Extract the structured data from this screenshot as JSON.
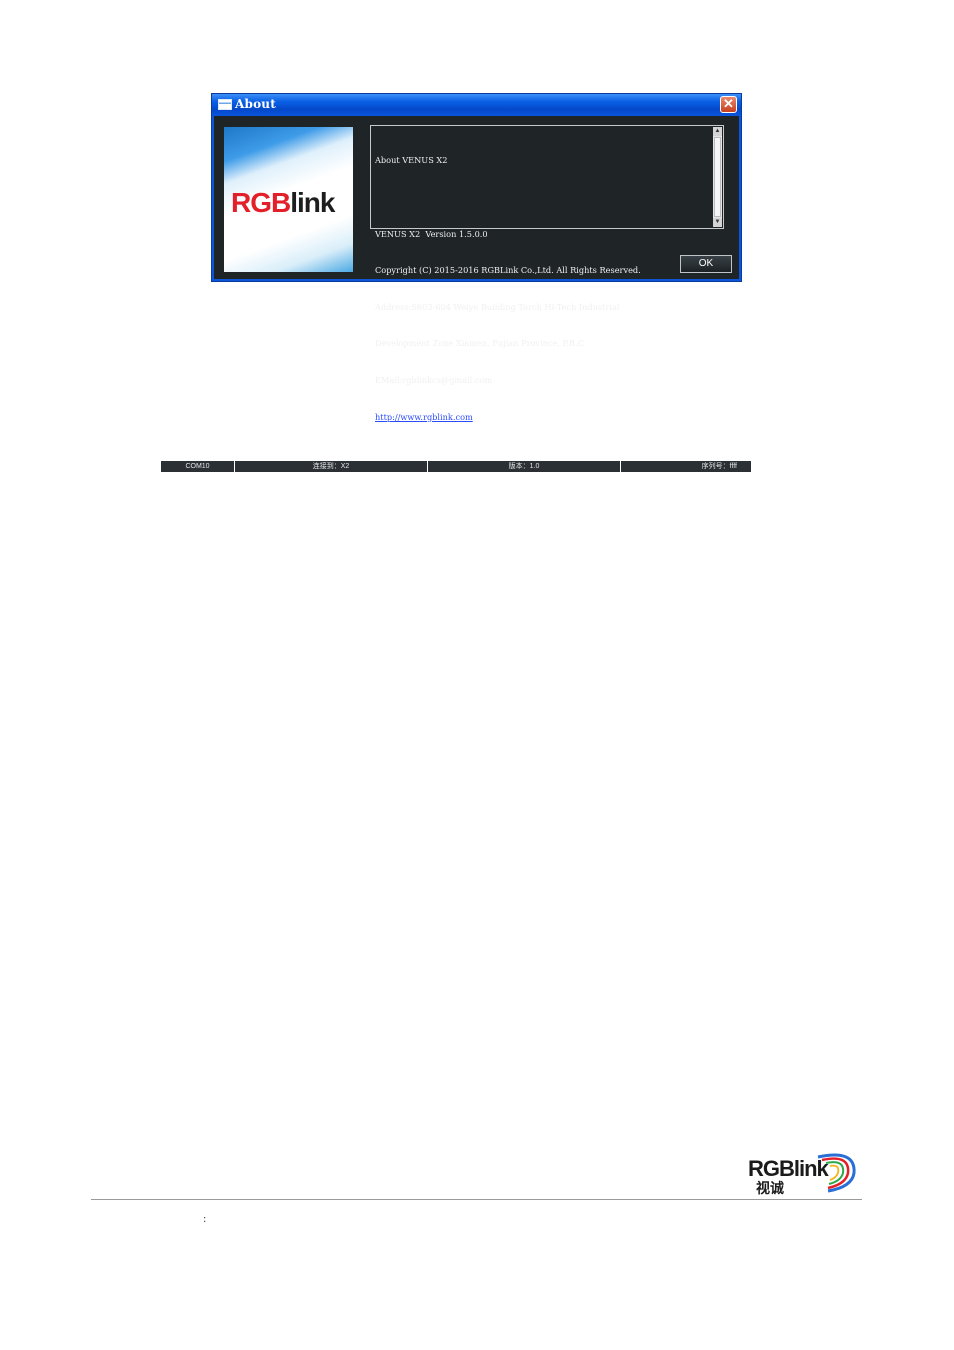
{
  "dialog": {
    "title": "About",
    "close_glyph": "✕",
    "logo_text": {
      "red": "RGB",
      "dark": "link"
    },
    "info_lines": [
      "About VENUS X2",
      "",
      "VENUS X2  Version 1.5.0.0",
      "Copyright (C) 2015-2016 RGBLink Co.,Ltd. All Rights Reserved.",
      "Address:S603-604 Weiye Building Torch Hi-Tech Industrial",
      "Development Zone Xiamen, Fujian Province, P.R.C",
      "EMail:rgblinkcs@gmail.com"
    ],
    "link_text": "http://www.rgblink.com",
    "ok_label": "OK",
    "icons": {
      "title": "window-icon",
      "close": "close-icon",
      "scroll_up": "arrow-up-icon",
      "scroll_down": "arrow-down-icon"
    }
  },
  "status_bar": {
    "port": "COM10",
    "device": "连接到：X2",
    "version": "版本：1.0",
    "serial": "序列号：ffff"
  },
  "footer": {
    "logo_text": "RGBlink",
    "logo_cn": "视诚",
    "colon": ":"
  },
  "colors": {
    "titlebar": "#0a5fe6",
    "dialog_bg": "#1f2427",
    "logo_red": "#e3202a",
    "link": "#2b4bff"
  }
}
